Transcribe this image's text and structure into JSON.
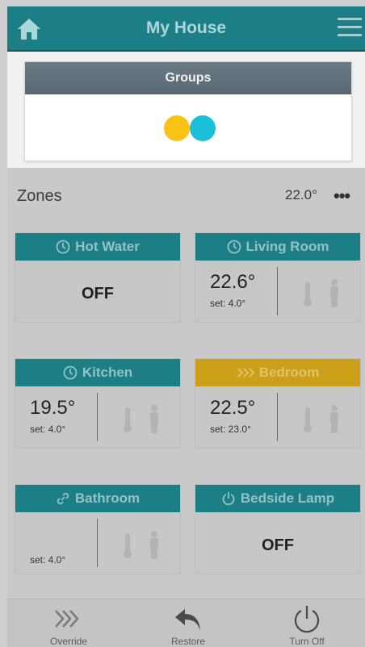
{
  "header": {
    "title": "My House",
    "home_icon": "home-icon",
    "menu_icon": "hamburger-menu-icon"
  },
  "groups": {
    "title": "Groups",
    "colors": [
      "#f9c316",
      "#1bbfd9"
    ]
  },
  "zones": {
    "title": "Zones",
    "temperature": "22.0°",
    "more": "•••",
    "items": [
      {
        "name": "Hot Water",
        "icon": "clock-icon",
        "status": "OFF"
      },
      {
        "name": "Living Room",
        "icon": "clock-icon",
        "temp": "22.6°",
        "set": "set: 4.0°"
      },
      {
        "name": "Kitchen",
        "icon": "clock-icon",
        "temp": "19.5°",
        "set": "set: 4.0°"
      },
      {
        "name": "Bedroom",
        "icon": "boost-chevrons-icon",
        "temp": "22.5°",
        "set": "set: 23.0°",
        "color": "#cc9f18"
      },
      {
        "name": "Bathroom",
        "icon": "link-icon",
        "set": "set: 4.0°"
      },
      {
        "name": "Bedside Lamp",
        "icon": "power-icon",
        "status": "OFF"
      }
    ]
  },
  "bottom_bar": {
    "override": "Override",
    "restore": "Restore",
    "turn_off": "Turn Off"
  }
}
